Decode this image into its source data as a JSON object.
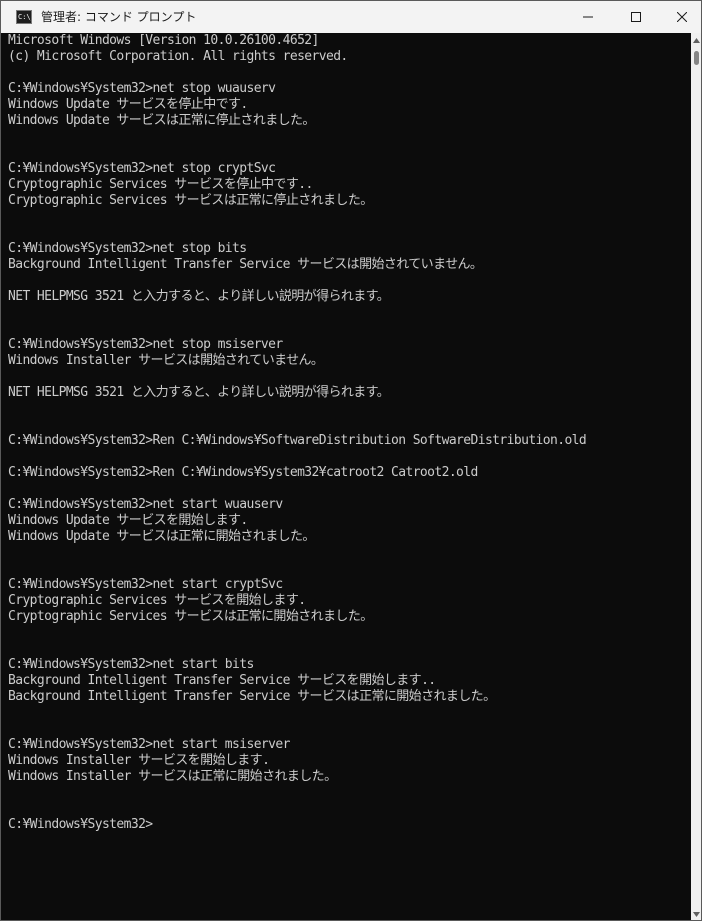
{
  "window": {
    "title": "管理者: コマンド プロンプト",
    "app_icon_text": "C:\\_"
  },
  "console": {
    "lines": [
      "Microsoft Windows [Version 10.0.26100.4652]",
      "(c) Microsoft Corporation. All rights reserved.",
      "",
      "C:¥Windows¥System32>net stop wuauserv",
      "Windows Update サービスを停止中です.",
      "Windows Update サービスは正常に停止されました。",
      "",
      "",
      "C:¥Windows¥System32>net stop cryptSvc",
      "Cryptographic Services サービスを停止中です..",
      "Cryptographic Services サービスは正常に停止されました。",
      "",
      "",
      "C:¥Windows¥System32>net stop bits",
      "Background Intelligent Transfer Service サービスは開始されていません。",
      "",
      "NET HELPMSG 3521 と入力すると、より詳しい説明が得られます。",
      "",
      "",
      "C:¥Windows¥System32>net stop msiserver",
      "Windows Installer サービスは開始されていません。",
      "",
      "NET HELPMSG 3521 と入力すると、より詳しい説明が得られます。",
      "",
      "",
      "C:¥Windows¥System32>Ren C:¥Windows¥SoftwareDistribution SoftwareDistribution.old",
      "",
      "C:¥Windows¥System32>Ren C:¥Windows¥System32¥catroot2 Catroot2.old",
      "",
      "C:¥Windows¥System32>net start wuauserv",
      "Windows Update サービスを開始します.",
      "Windows Update サービスは正常に開始されました。",
      "",
      "",
      "C:¥Windows¥System32>net start cryptSvc",
      "Cryptographic Services サービスを開始します.",
      "Cryptographic Services サービスは正常に開始されました。",
      "",
      "",
      "C:¥Windows¥System32>net start bits",
      "Background Intelligent Transfer Service サービスを開始します..",
      "Background Intelligent Transfer Service サービスは正常に開始されました。",
      "",
      "",
      "C:¥Windows¥System32>net start msiserver",
      "Windows Installer サービスを開始します.",
      "Windows Installer サービスは正常に開始されました。",
      "",
      "",
      "C:¥Windows¥System32>"
    ]
  },
  "icons": {
    "minimize": "minimize-icon",
    "maximize": "maximize-icon",
    "close": "close-icon",
    "scroll_up": "scroll-up-arrow-icon",
    "scroll_down": "scroll-down-arrow-icon"
  },
  "colors": {
    "console_background": "#0c0c0c",
    "console_text": "#cccccc",
    "titlebar_background": "#f3f3f3",
    "scrollbar_track": "#f0f0f0",
    "scrollbar_thumb": "#858585"
  }
}
